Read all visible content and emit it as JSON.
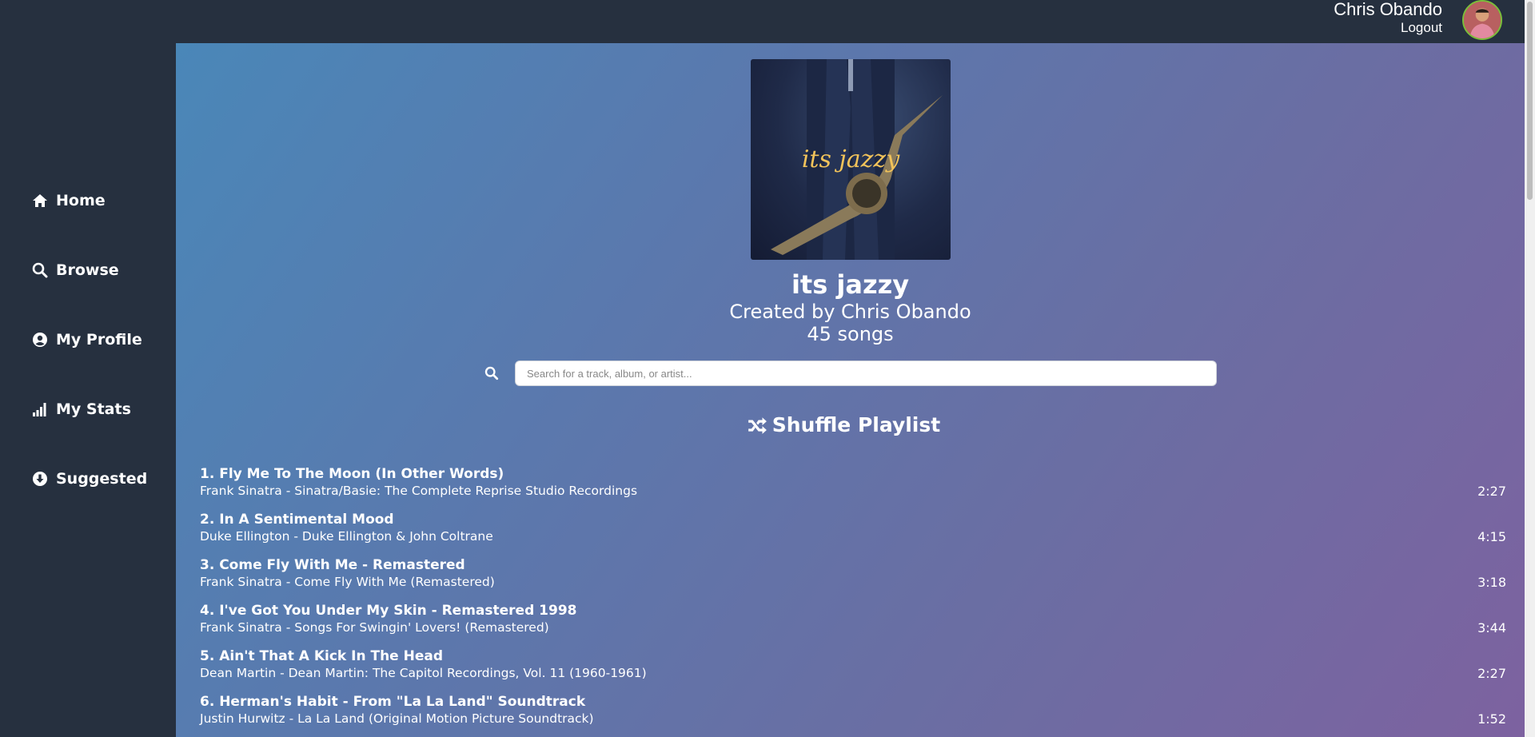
{
  "header": {
    "user_name": "Chris Obando",
    "logout_label": "Logout"
  },
  "sidebar": {
    "items": [
      {
        "label": "Home",
        "icon": "home-icon"
      },
      {
        "label": "Browse",
        "icon": "search-icon"
      },
      {
        "label": "My Profile",
        "icon": "user-circle-icon"
      },
      {
        "label": "My Stats",
        "icon": "signal-bars-icon"
      },
      {
        "label": "Suggested",
        "icon": "arrow-down-circle-icon"
      }
    ]
  },
  "playlist": {
    "cover_text": "its jazzy",
    "title": "its jazzy",
    "creator": "Created by Chris Obando",
    "count": "45 songs"
  },
  "search": {
    "placeholder": "Search for a track, album, or artist...",
    "value": ""
  },
  "shuffle_label": "Shuffle Playlist",
  "tracks": [
    {
      "title": "1. Fly Me To The Moon (In Other Words)",
      "subtitle": "Frank Sinatra - Sinatra/Basie: The Complete Reprise Studio Recordings",
      "duration": "2:27"
    },
    {
      "title": "2. In A Sentimental Mood",
      "subtitle": "Duke Ellington - Duke Ellington & John Coltrane",
      "duration": "4:15"
    },
    {
      "title": "3. Come Fly With Me - Remastered",
      "subtitle": "Frank Sinatra - Come Fly With Me (Remastered)",
      "duration": "3:18"
    },
    {
      "title": "4. I've Got You Under My Skin - Remastered 1998",
      "subtitle": "Frank Sinatra - Songs For Swingin' Lovers! (Remastered)",
      "duration": "3:44"
    },
    {
      "title": "5. Ain't That A Kick In The Head",
      "subtitle": "Dean Martin - Dean Martin: The Capitol Recordings, Vol. 11 (1960-1961)",
      "duration": "2:27"
    },
    {
      "title": "6. Herman's Habit - From \"La La Land\" Soundtrack",
      "subtitle": "Justin Hurwitz - La La Land (Original Motion Picture Soundtrack)",
      "duration": "1:52"
    }
  ],
  "colors": {
    "sidebar_bg": "#26303f",
    "gradient_start": "#4a87b8",
    "gradient_end": "#7d62a0",
    "cover_text": "#f2c35a"
  }
}
